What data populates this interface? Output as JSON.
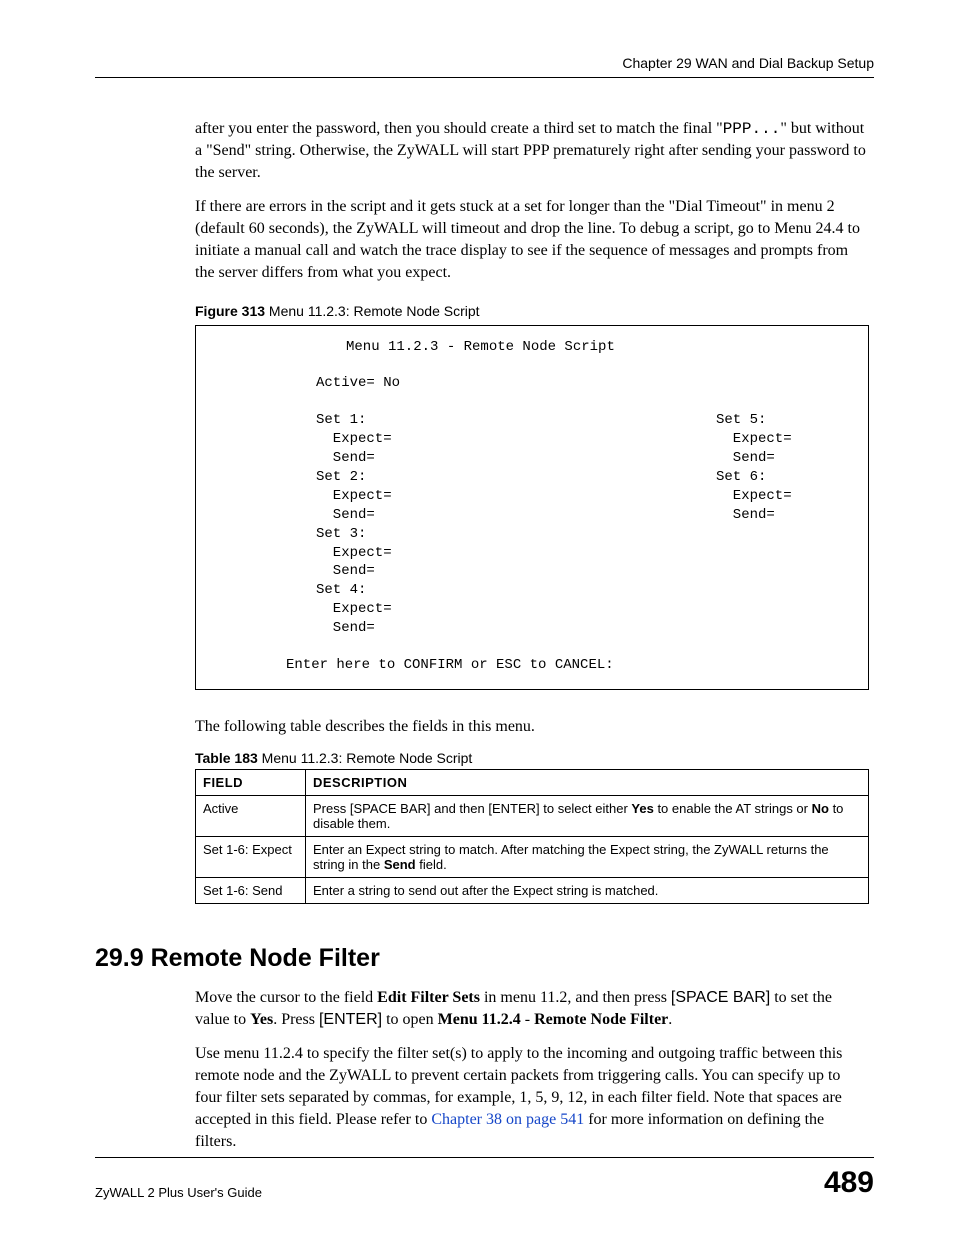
{
  "header": "Chapter 29 WAN and Dial Backup Setup",
  "para1": {
    "t1": "after you enter the password, then you should create a third set to match the final \"",
    "code": "PPP...",
    "t2": "\" but without a \"Send\" string. Otherwise, the ZyWALL will start PPP prematurely right after sending your password to the server."
  },
  "para2": "If there are errors in the script and it gets stuck at a set for longer than the \"Dial Timeout\" in menu 2 (default 60 seconds), the ZyWALL will timeout and drop the line. To debug a script, go to Menu 24.4 to initiate a manual call and watch the trace display to see if the sequence of messages and prompts from the server differs from what you expect.",
  "figcap": {
    "label": "Figure 313",
    "text": "   Menu 11.2.3: Remote Node Script"
  },
  "figure": {
    "title": "Menu 11.2.3 - Remote Node Script",
    "active": "Active= No",
    "left": [
      "Set 1:",
      "  Expect=",
      "  Send=",
      "Set 2:",
      "  Expect=",
      "  Send=",
      "Set 3:",
      "  Expect=",
      "  Send=",
      "Set 4:",
      "  Expect=",
      "  Send="
    ],
    "right": [
      "Set 5:",
      "  Expect=",
      "  Send=",
      "Set 6:",
      "  Expect=",
      "  Send="
    ],
    "bottom": "Enter here to CONFIRM or ESC to CANCEL:"
  },
  "para3": "The following table describes the fields in this menu.",
  "tabcap": {
    "label": "Table 183",
    "text": "   Menu 11.2.3: Remote Node Script"
  },
  "table": {
    "headers": [
      "FIELD",
      "DESCRIPTION"
    ],
    "rows": [
      {
        "field": "Active",
        "d_pre": "Press [SPACE BAR] and then [ENTER] to select either ",
        "b1": "Yes",
        "d_mid": " to enable the AT strings or ",
        "b2": "No",
        "d_post": " to disable them."
      },
      {
        "field": "Set 1-6: Expect",
        "d_pre": "Enter an Expect string to match. After matching the Expect string, the ZyWALL returns the string in the ",
        "b1": "Send",
        "d_post": " field."
      },
      {
        "field": "Set 1-6: Send",
        "d_pre": "Enter a string to send out after the Expect string is matched."
      }
    ]
  },
  "section": "29.9  Remote Node Filter",
  "para4": {
    "t1": "Move the cursor to the field ",
    "b1": "Edit Filter Sets",
    "t2": " in menu 11.2, and then press ",
    "k1": "[SPACE BAR]",
    "t3": " to set the value to ",
    "b2": "Yes",
    "t4": ". Press ",
    "k2": "[ENTER]",
    "t5": " to open ",
    "b3": "Menu 11.2.4",
    "t6": " - ",
    "b4": "Remote Node Filter",
    "t7": "."
  },
  "para5": {
    "t1": "Use menu 11.2.4 to specify the filter set(s) to apply to the incoming and outgoing traffic between this remote node and the ZyWALL to prevent certain packets from triggering calls. You can specify up to four filter sets separated by commas, for example, 1, 5, 9, 12, in each filter field. Note that spaces are accepted in this field. Please refer to ",
    "link": "Chapter 38 on page 541",
    "t2": " for more information on defining the filters."
  },
  "footer": {
    "left": "ZyWALL 2 Plus User's Guide",
    "right": "489"
  }
}
